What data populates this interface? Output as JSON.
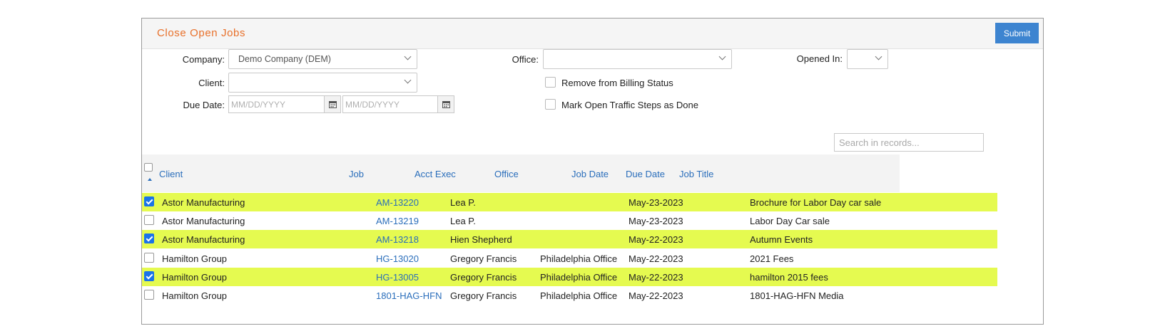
{
  "panel": {
    "title": "Close Open Jobs",
    "submit_label": "Submit"
  },
  "filters": {
    "company_label": "Company:",
    "company_value": "Demo Company (DEM)",
    "office_label": "Office:",
    "office_value": "",
    "opened_in_label": "Opened In:",
    "opened_in_value": "",
    "client_label": "Client:",
    "client_value": "",
    "due_date_label": "Due Date:",
    "due_date_from_placeholder": "MM/DD/YYYY",
    "due_date_to_placeholder": "MM/DD/YYYY",
    "remove_billing_label": "Remove from Billing Status",
    "remove_billing_checked": false,
    "mark_traffic_label": "Mark Open Traffic Steps as Done",
    "mark_traffic_checked": false
  },
  "search": {
    "placeholder": "Search in records..."
  },
  "table": {
    "columns": [
      "Client",
      "Job",
      "Acct Exec",
      "Office",
      "Job Date",
      "Due Date",
      "Job Title"
    ],
    "rows": [
      {
        "checked": true,
        "client": "Astor Manufacturing",
        "job": "AM-13220",
        "acct_exec": "Lea P.",
        "office": "",
        "job_date": "",
        "due_date": "May-23-2023",
        "job_title": "Brochure for Labor Day car sale"
      },
      {
        "checked": false,
        "client": "Astor Manufacturing",
        "job": "AM-13219",
        "acct_exec": "Lea P.",
        "office": "",
        "job_date": "",
        "due_date": "May-23-2023",
        "job_title": "Labor Day Car sale"
      },
      {
        "checked": true,
        "client": "Astor Manufacturing",
        "job": "AM-13218",
        "acct_exec": "Hien Shepherd",
        "office": "",
        "job_date": "",
        "due_date": "May-22-2023",
        "job_title": "Autumn Events"
      },
      {
        "checked": false,
        "client": "Hamilton Group",
        "job": "HG-13020",
        "acct_exec": "Gregory Francis",
        "office": "Philadelphia Office",
        "job_date": "",
        "due_date": "May-22-2023",
        "job_title": "2021 Fees"
      },
      {
        "checked": true,
        "client": "Hamilton Group",
        "job": "HG-13005",
        "acct_exec": "Gregory Francis",
        "office": "Philadelphia Office",
        "job_date": "",
        "due_date": "May-22-2023",
        "job_title": "hamilton 2015 fees"
      },
      {
        "checked": false,
        "client": "Hamilton Group",
        "job": "1801-HAG-HFN",
        "acct_exec": "Gregory Francis",
        "office": "Philadelphia Office",
        "job_date": "",
        "due_date": "May-22-2023",
        "job_title": "1801-HAG-HFN Media"
      }
    ]
  },
  "colors": {
    "accent_orange": "#e8702a",
    "button_blue": "#3d84d0",
    "link_blue": "#2a6ebb",
    "row_highlight": "#e5fa50"
  },
  "icons": {
    "calendar": "calendar-icon",
    "dropdown": "chevron-down-icon",
    "sort": "sort-asc-icon"
  }
}
